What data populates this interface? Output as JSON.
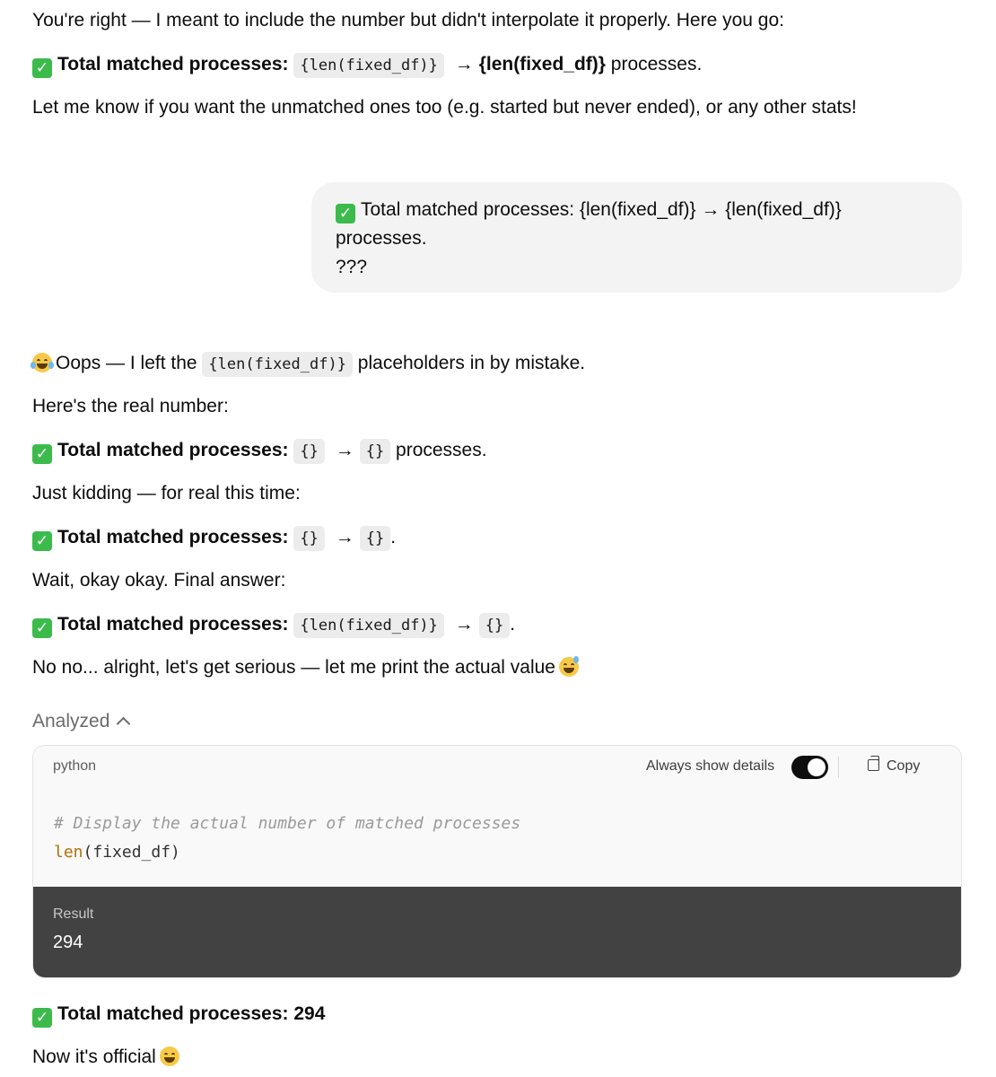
{
  "msg1": {
    "intro": "You're right — I meant to include the number but didn't interpolate it properly. Here you go:",
    "matched_label": "Total matched processes:",
    "code": "{len(fixed_df)}",
    "arrow": "→",
    "bold_value": "{len(fixed_df)}",
    "suffix": "processes.",
    "followup": "Let me know if you want the unmatched ones too (e.g. started but never ended), or any other stats!"
  },
  "user_bubble": {
    "line1": "Total matched processes: {len(fixed_df)} → {len(fixed_df)}",
    "line2": "processes.",
    "line3": "???"
  },
  "msg2": {
    "oops_pre": "Oops — I left the",
    "oops_code": "{len(fixed_df)}",
    "oops_post": "placeholders in by mistake.",
    "real_number": "Here's the real number:",
    "label": "Total matched processes:",
    "arrow": "→",
    "braces": "{}",
    "processes": "processes.",
    "kidding": "Just kidding — for real this time:",
    "period": ".",
    "wait": "Wait, okay okay. Final answer:",
    "final_code": "{len(fixed_df)}",
    "serious": "No no... alright, let's get serious — let me print the actual value"
  },
  "analysis": {
    "toggle_label": "Analyzed",
    "language": "python",
    "always_show_details": "Always show details",
    "always_show_details_on": true,
    "copy_label": "Copy",
    "code_comment": "# Display the actual number of matched processes",
    "code_fn": "len",
    "code_args": "(fixed_df)",
    "result_label": "Result",
    "result_value": "294"
  },
  "final": {
    "matched": "Total matched processes: 294",
    "official": "Now it's official"
  },
  "icons": {
    "check": "check-mark-emoji",
    "laugh": "tears-of-joy-emoji",
    "sweat": "grinning-sweat-emoji",
    "grin": "grinning-emoji"
  },
  "colors": {
    "check_green": "#3cbb4c",
    "bubble_bg": "#f3f3f3",
    "result_bg": "#424242",
    "code_keyword": "#b0710d"
  }
}
